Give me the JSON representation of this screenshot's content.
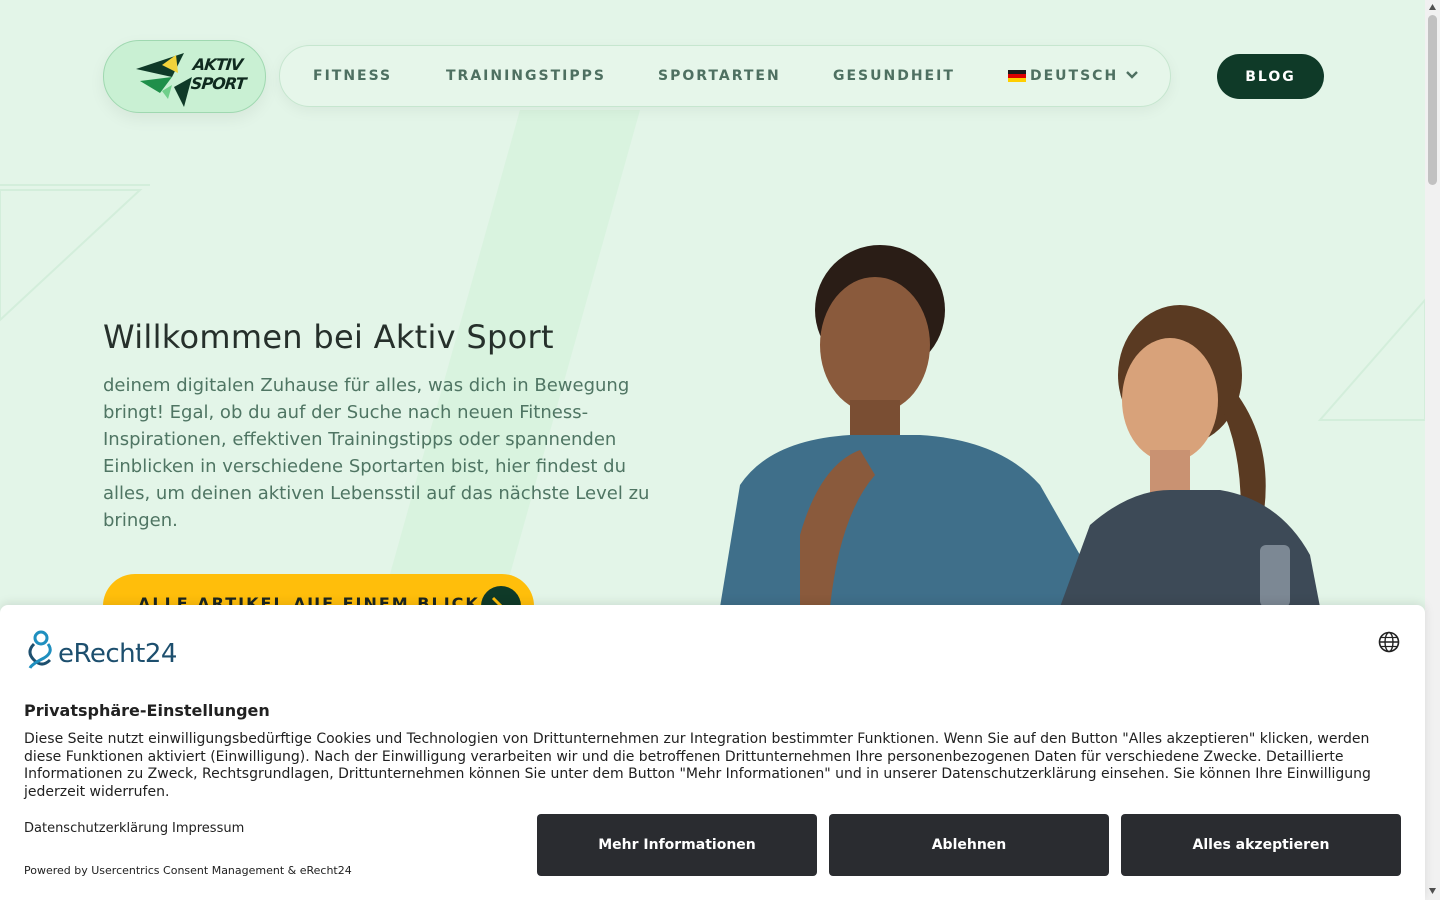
{
  "header": {
    "logo_line1": "AKTIV",
    "logo_line2": "SPORT",
    "nav": [
      {
        "label": "FITNESS"
      },
      {
        "label": "TRAININGSTIPPS"
      },
      {
        "label": "SPORTARTEN"
      },
      {
        "label": "GESUNDHEIT"
      }
    ],
    "language": "DEUTSCH",
    "blog_label": "BLOG"
  },
  "hero": {
    "title": "Willkommen bei Aktiv Sport",
    "text": "deinem digitalen Zuhause für alles, was dich in Bewegung bringt! Egal, ob du auf der Suche nach neuen Fitness-Inspirationen, effektiven Trainingstipps oder spannenden Einblicken in verschiedene Sportarten bist, hier findest du alles, um deinen aktiven Lebensstil auf das nächste Level zu bringen.",
    "cta_label": "ALLE ARTIKEL AUF EINEM BLICK"
  },
  "consent": {
    "brand": "eRecht24",
    "title": "Privatsphäre-Einstellungen",
    "text": "Diese Seite nutzt einwilligungsbedürftige Cookies und Technologien von Drittunternehmen zur Integration bestimmter Funktionen. Wenn Sie auf den Button \"Alles akzeptieren\" klicken, werden diese Funktionen aktiviert (Einwilligung). Nach der Einwilligung verarbeiten wir und die betroffenen Drittunternehmen Ihre personenbezogenen Daten für verschiedene Zwecke. Detaillierte Informationen zu Zweck, Rechtsgrundlagen, Drittunternehmen können Sie unter dem Button \"Mehr Informationen\" und in unserer Datenschutzerklärung einsehen. Sie können Ihre Einwilligung jederzeit widerrufen.",
    "link_privacy": "Datenschutzerklärung",
    "link_imprint": "Impressum",
    "powered_by": "Powered by Usercentrics Consent Management & eRecht24",
    "btn_more": "Mehr Informationen",
    "btn_decline": "Ablehnen",
    "btn_accept": "Alles akzeptieren"
  },
  "colors": {
    "background": "#e3f5e8",
    "brand_dark": "#0f3a28",
    "cta_yellow": "#ffbe0b",
    "consent_button": "#2a2c30"
  },
  "icons": [
    "logo-mark",
    "german-flag-icon",
    "chevron-down-icon",
    "arrow-icon",
    "globe-icon",
    "erecht24-logo-icon"
  ]
}
